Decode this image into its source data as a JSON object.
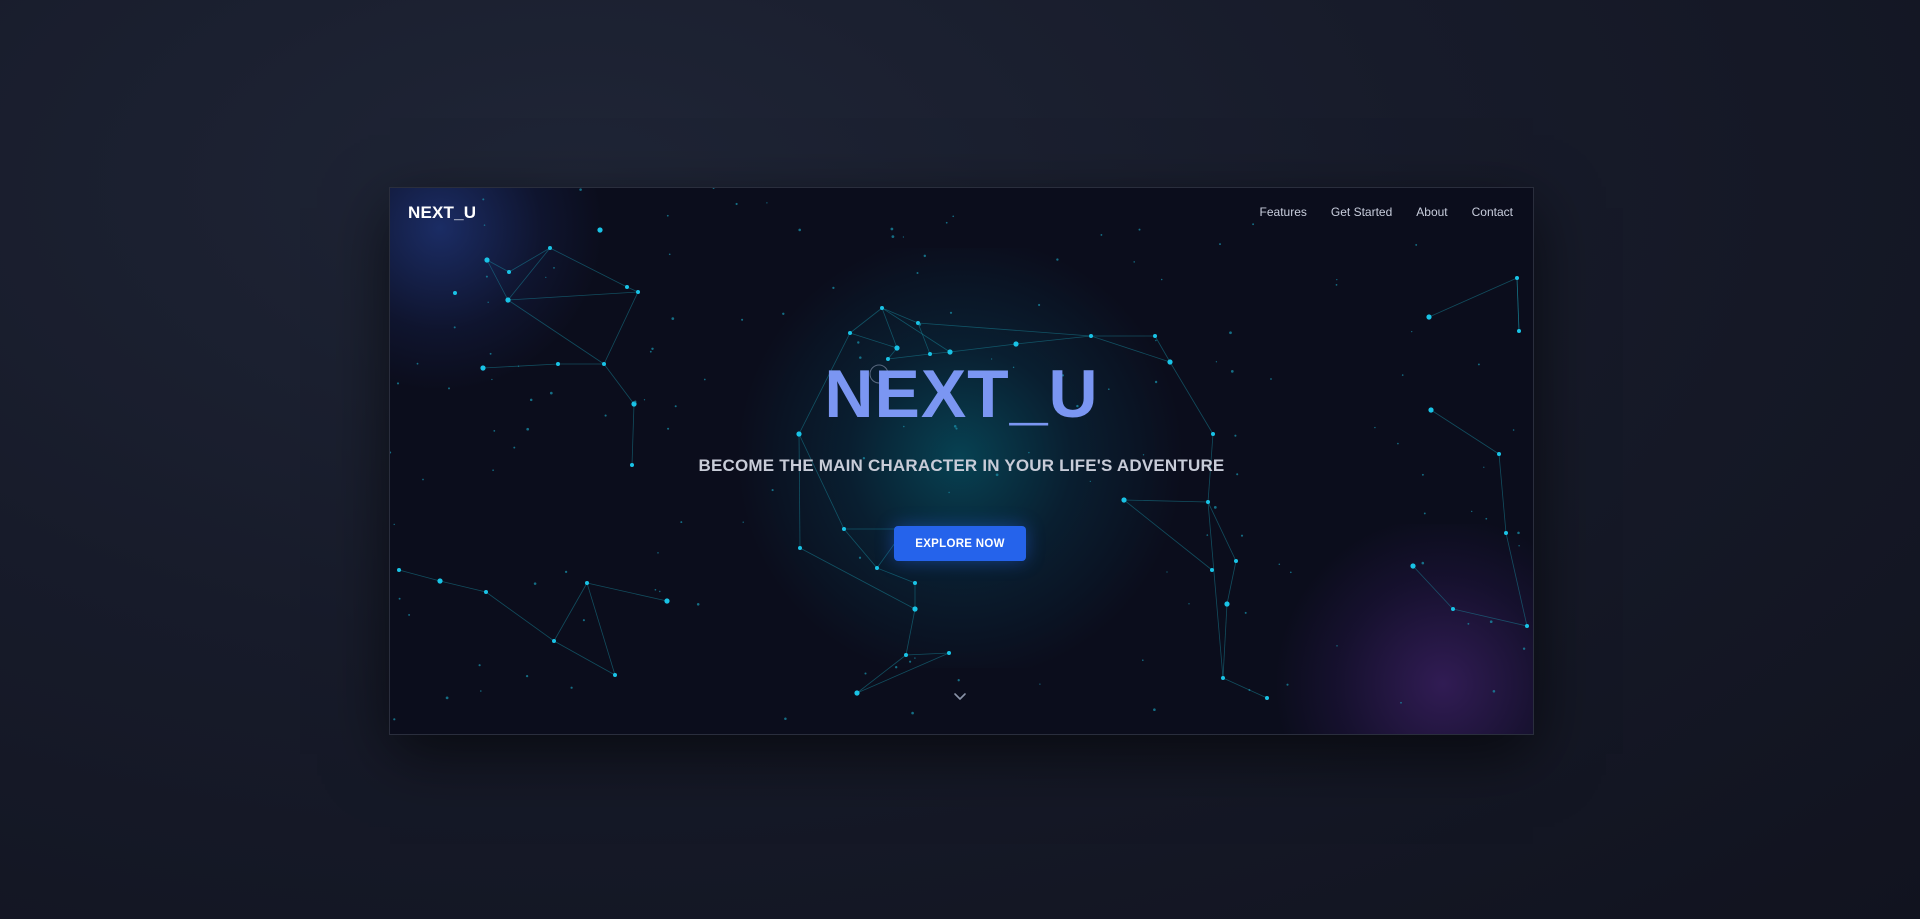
{
  "nav": {
    "logo": "NEXT_U",
    "links": [
      "Features",
      "Get Started",
      "About",
      "Contact"
    ]
  },
  "hero": {
    "title": "NEXT_U",
    "subtitle": "BECOME THE MAIN CHARACTER IN YOUR LIFE'S ADVENTURE",
    "cta_label": "EXPLORE NOW"
  },
  "icons": {
    "scroll": "chevron-down-icon",
    "cursor": "cursor-ring-icon"
  },
  "colors": {
    "background": "#0b0d1c",
    "accent": "#2563eb",
    "title": "#7b96f2",
    "particles": "#19c3e6"
  }
}
